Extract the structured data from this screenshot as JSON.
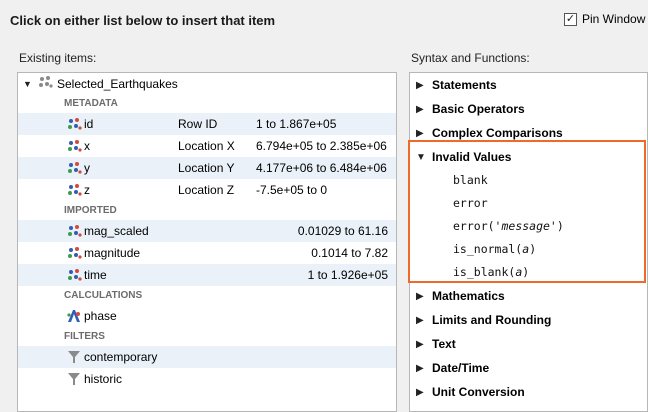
{
  "header": {
    "title": "Click on either list below to insert that item"
  },
  "pin": {
    "checked_mark": "✓",
    "label": "Pin Window"
  },
  "existing": {
    "label": "Existing items:",
    "root": "Selected_Earthquakes",
    "groups": {
      "metadata": "METADATA",
      "imported": "IMPORTED",
      "calculations": "CALCULATIONS",
      "filters": "FILTERS"
    },
    "metadata_items": [
      {
        "name": "id",
        "type": "Row ID",
        "range": "1 to 1.867e+05"
      },
      {
        "name": "x",
        "type": "Location X",
        "range": "6.794e+05 to 2.385e+06"
      },
      {
        "name": "y",
        "type": "Location Y",
        "range": "4.177e+06 to 6.484e+06"
      },
      {
        "name": "z",
        "type": "Location Z",
        "range": "-7.5e+05 to 0"
      }
    ],
    "imported_items": [
      {
        "name": "mag_scaled",
        "range": "0.01029 to 61.16"
      },
      {
        "name": "magnitude",
        "range": "0.1014 to 7.82"
      },
      {
        "name": "time",
        "range": "1 to 1.926e+05"
      }
    ],
    "calculation_items": [
      {
        "name": "phase"
      }
    ],
    "filter_items": [
      {
        "name": "contemporary"
      },
      {
        "name": "historic"
      }
    ]
  },
  "syntax": {
    "label": "Syntax and Functions:",
    "categories_before": [
      "Statements",
      "Basic Operators",
      "Complex Comparisons"
    ],
    "expanded": {
      "label": "Invalid Values",
      "functions": [
        {
          "text": "blank"
        },
        {
          "text": "error"
        },
        {
          "text": "error(",
          "arg": "'message'",
          "close": ")"
        },
        {
          "text": "is_normal(",
          "arg": "a",
          "close": ")"
        },
        {
          "text": "is_blank(",
          "arg": "a",
          "close": ")"
        }
      ]
    },
    "categories_after": [
      "Mathematics",
      "Limits and Rounding",
      "Text",
      "Date/Time",
      "Unit Conversion"
    ]
  },
  "colors": {
    "highlight": "#ee6a2a",
    "alt_row": "#eaf1f9"
  }
}
